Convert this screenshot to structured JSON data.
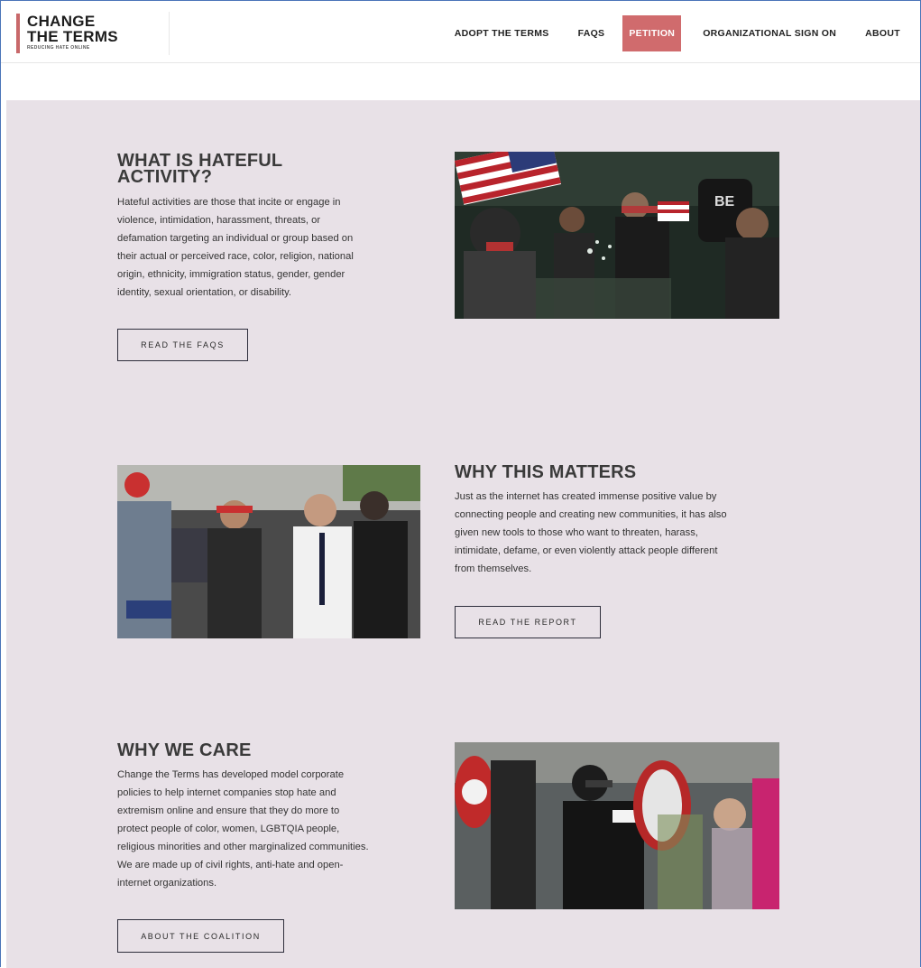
{
  "header": {
    "logo": {
      "line1": "CHANGE",
      "line2": "THE TERMS",
      "tagline": "REDUCING HATE ONLINE"
    },
    "nav": [
      {
        "label": "ADOPT THE TERMS",
        "active": false
      },
      {
        "label": "FAQS",
        "active": false
      },
      {
        "label": "PETITION",
        "active": true
      },
      {
        "label": "ORGANIZATIONAL SIGN ON",
        "active": false
      },
      {
        "label": "ABOUT",
        "active": false
      }
    ]
  },
  "sections": [
    {
      "title_line1": "WHAT IS HATEFUL",
      "title_line2": "ACTIVITY?",
      "body": [
        "Hateful activities are those that incite or engage in",
        "violence, intimidation, harassment, threats, or",
        "defamation targeting an individual or group based on",
        "their actual or perceived race, color, religion, national",
        "origin, ethnicity, immigration status, gender, gender",
        "identity, sexual orientation, or disability."
      ],
      "button": "READ THE FAQS"
    },
    {
      "title_line1": "WHY THIS MATTERS",
      "body": [
        "Just as the internet has created immense positive value by",
        "connecting people and creating new communities, it has also",
        "given new tools to those who want to threaten, harass,",
        "intimidate, defame, or even violently attack people different",
        "from themselves."
      ],
      "button": "READ THE REPORT"
    },
    {
      "title_line1": "WHY WE CARE",
      "body": [
        "Change the Terms has developed model corporate",
        "policies to help internet companies stop hate and",
        "extremism online and ensure that they do more to",
        "protect people of color, women, LGBTQIA people,",
        "religious minorities and other marginalized communities.",
        "We are made up of civil rights, anti-hate and open-",
        "internet organizations."
      ],
      "button": "ABOUT THE COALITION"
    }
  ],
  "photo_text": {
    "shirt": "BE"
  },
  "colors": {
    "accent": "#d06b6d",
    "background": "#e8e1e7",
    "frame": "#4a74b8"
  }
}
